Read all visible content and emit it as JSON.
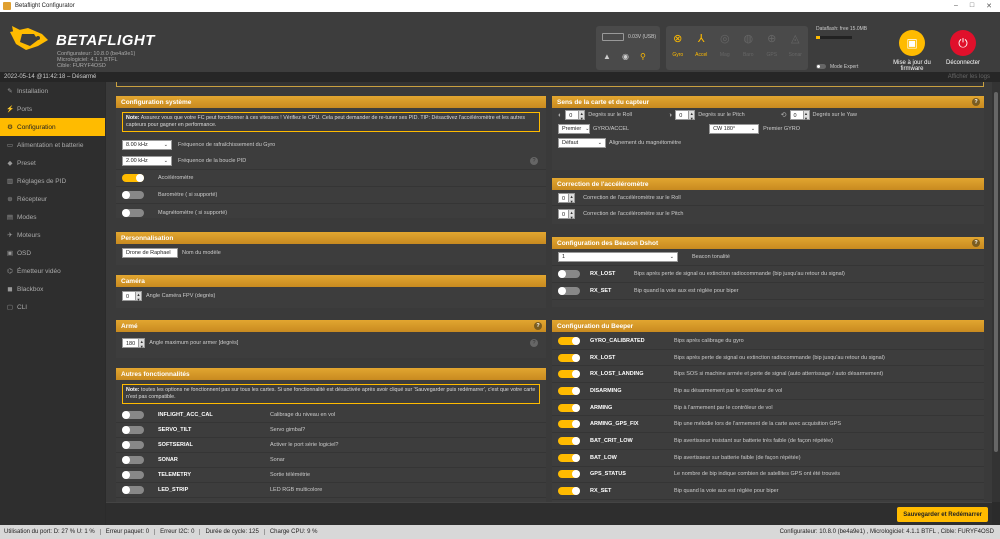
{
  "window": {
    "title": "Betaflight Configurator",
    "minimize": "–",
    "maximize": "□",
    "close": "✕"
  },
  "logo": {
    "brand": "BETAFLIGHT",
    "configurator": "Configurateur: 10.8.0 (be4a9e1)",
    "firmware": "Micrologiciel: 4.1.1 BTFL",
    "target": "Cible: FURYF4OSD"
  },
  "port": {
    "battery_label": "0.03V (USB)"
  },
  "sensors": [
    {
      "label": "Gyro",
      "icon": "gyro-icon",
      "on": true
    },
    {
      "label": "Accel",
      "icon": "accel-icon",
      "on": true
    },
    {
      "label": "Mag",
      "icon": "mag-icon",
      "on": false
    },
    {
      "label": "Baro",
      "icon": "baro-icon",
      "on": false
    },
    {
      "label": "GPS",
      "icon": "gps-icon",
      "on": false
    },
    {
      "label": "Sonar",
      "icon": "sonar-icon",
      "on": false
    }
  ],
  "dataflash": {
    "text": "Dataflash: free 15.0MB",
    "expert_label": "Mode Expert",
    "used_fraction": 0.1
  },
  "update_firmware": "Mise à jour du firmware",
  "disconnect": "Déconnecter",
  "topstatus": {
    "datetime": "2022-05-14 @11:42:18 – Désarmé",
    "show_logs": "Afficher les logs"
  },
  "sidebar": [
    {
      "label": "Installation",
      "icon": "wrench-icon"
    },
    {
      "label": "Ports",
      "icon": "plug-icon"
    },
    {
      "label": "Configuration",
      "icon": "gear-icon",
      "active": true
    },
    {
      "label": "Alimentation et batterie",
      "icon": "battery-icon"
    },
    {
      "label": "Preset",
      "icon": "preset-icon"
    },
    {
      "label": "Réglages de PID",
      "icon": "pid-icon"
    },
    {
      "label": "Récepteur",
      "icon": "receiver-icon"
    },
    {
      "label": "Modes",
      "icon": "modes-icon"
    },
    {
      "label": "Moteurs",
      "icon": "motor-icon"
    },
    {
      "label": "OSD",
      "icon": "osd-icon"
    },
    {
      "label": "Émetteur vidéo",
      "icon": "vtx-icon"
    },
    {
      "label": "Blackbox",
      "icon": "blackbox-icon"
    },
    {
      "label": "CLI",
      "icon": "cli-icon"
    }
  ],
  "system": {
    "title": "Configuration système",
    "note_bold": "Note:",
    "note": "Assurez vous que votre FC peut fonctionner à ces vitesses ! Vérifiez le CPU. Cela peut demander de re-tuner ses PID. TIP: Désactivez l'accéléromètre et les autres capteurs pour gagner en performance.",
    "gyro_freq": "8.00 kHz",
    "gyro_label": "Fréquence de rafraîchissement du Gyro",
    "pid_freq": "2.00 kHz",
    "pid_label": "Fréquence de la boucle PID",
    "acc_label": "Accéléromètre",
    "baro_label": "Baromètre ( si supporté)",
    "mag_label": "Magnétomètre ( si supporté)"
  },
  "personal": {
    "title": "Personnalisation",
    "name_value": "Drone de Raphael",
    "name_label": "Nom du modèle"
  },
  "camera": {
    "title": "Caméra",
    "angle_value": "0",
    "angle_label": "Angle Caméra FPV (degrés)"
  },
  "arm": {
    "title": "Armé",
    "angle_value": "180",
    "angle_label": "Angle maximum pour armer [degrés]"
  },
  "other": {
    "title": "Autres fonctionnalités",
    "note_bold": "Note:",
    "note": "toutes les options ne fonctionnent pas sur tous les cartes. Si une fonctionnalité est désactivée après avoir cliqué sur 'Sauvegarder puis redémarrer', c'est que votre carte n'est pas compatible.",
    "features": [
      {
        "name": "INFLIGHT_ACC_CAL",
        "desc": "Calibrage du niveau en vol",
        "help": false
      },
      {
        "name": "SERVO_TILT",
        "desc": "Servo gimbal",
        "help": true
      },
      {
        "name": "SOFTSERIAL",
        "desc": "Activer le port série logiciel",
        "help": true
      },
      {
        "name": "SONAR",
        "desc": "Sonar",
        "help": false
      },
      {
        "name": "TELEMETRY",
        "desc": "Sortie télémétrie",
        "help": false
      },
      {
        "name": "LED_STRIP",
        "desc": "LED RGB multicolore",
        "help": false
      }
    ]
  },
  "alignment": {
    "title": "Sens de la carte et du capteur",
    "roll_value": "0",
    "roll_label": "Degrés sur le Roll",
    "pitch_value": "0",
    "pitch_label": "Degrés sur le Pitch",
    "yaw_value": "0",
    "yaw_label": "Degrés sur le Yaw",
    "gyro_sel": "Premier",
    "gyro_acc_label": "GYRO/ACCEL",
    "cw_sel": "CW 180°",
    "first_gyro_label": "Premier GYRO",
    "mag_sel": "Défaut",
    "mag_label": "Alignement du magnétomètre"
  },
  "acc_trim": {
    "title": "Correction de l'accéléromètre",
    "roll_value": "0",
    "roll_label": "Correction de l'accéléromètre sur le Roll",
    "pitch_value": "0",
    "pitch_label": "Correction de l'accéléromètre sur le Pitch"
  },
  "beacon": {
    "title": "Configuration des Beacon Dshot",
    "tone_value": "1",
    "tone_label": "Beacon tonalité",
    "items": [
      {
        "name": "RX_LOST",
        "desc": "Bips après perte de signal ou extinction radiocommande (bip jusqu'au retour du signal)"
      },
      {
        "name": "RX_SET",
        "desc": "Bip quand la voie aux est réglée pour biper"
      }
    ]
  },
  "beeper": {
    "title": "Configuration du Beeper",
    "items": [
      {
        "name": "GYRO_CALIBRATED",
        "desc": "Bips après calibrage du gyro"
      },
      {
        "name": "RX_LOST",
        "desc": "Bips après perte de signal ou extinction radiocommande (bip jusqu'au retour du signal)"
      },
      {
        "name": "RX_LOST_LANDING",
        "desc": "Bips SOS si machine armée et perte de signal (auto atterrissage / auto désarmement)"
      },
      {
        "name": "DISARMING",
        "desc": "Bip au désarmement par le contrôleur de vol"
      },
      {
        "name": "ARMING",
        "desc": "Bip à l'armement par le contrôleur de vol"
      },
      {
        "name": "ARMING_GPS_FIX",
        "desc": "Bip une mélodie lors de l'armement de la carte avec acquisition GPS"
      },
      {
        "name": "BAT_CRIT_LOW",
        "desc": "Bip avertisseur insistant sur batterie très faible (de façon répétée)"
      },
      {
        "name": "BAT_LOW",
        "desc": "Bip avertisseur sur batterie faible (de façon répétée)"
      },
      {
        "name": "GPS_STATUS",
        "desc": "Le nombre de bip indique combien de satellites GPS ont été trouvés"
      },
      {
        "name": "RX_SET",
        "desc": "Bip quand la voie aux est réglée pour biper"
      }
    ]
  },
  "save_button": "Sauvegarder et Redémarrer",
  "status": {
    "port": "Utilisation du port: D: 27 % U: 1 %",
    "packet": "Erreur paquet: 0",
    "i2c": "Erreur I2C: 0",
    "cycle": "Durée de cycle: 125",
    "cpu": "Charge CPU: 9 %",
    "right": "Configurateur: 10.8.0 (be4a9e1) , Micrologiciel: 4.1.1 BTFL , Cible: FURYF4OSD"
  },
  "colors": {
    "accent": "#ffbb00",
    "header_bg": "#3d3d3d",
    "update_btn": "#ffbb00",
    "disconnect_btn": "#e0102b"
  }
}
